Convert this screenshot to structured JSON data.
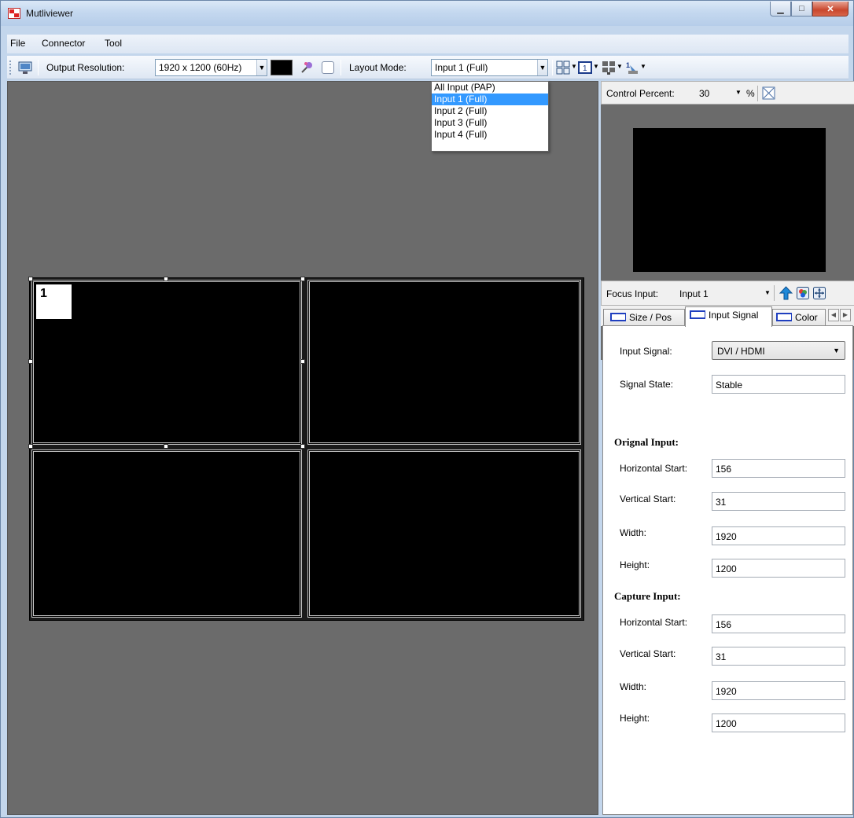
{
  "window": {
    "title": "Mutliviewer"
  },
  "menu": [
    "File",
    "Connector",
    "Tool"
  ],
  "toolbar": {
    "output_resolution_label": "Output Resolution:",
    "output_resolution_value": "1920 x 1200 (60Hz)",
    "layout_mode_label": "Layout Mode:",
    "layout_mode_value": "Input 1 (Full)"
  },
  "layout_dropdown": {
    "options": [
      "All Input (PAP)",
      "Input 1 (Full)",
      "Input 2 (Full)",
      "Input 3 (Full)",
      "Input 4 (Full)"
    ],
    "selected": "Input 1 (Full)"
  },
  "canvas": {
    "selected_cell_number": "1"
  },
  "right_panel": {
    "control_percent_label": "Control Percent:",
    "control_percent_value": "30",
    "percent_unit": "%",
    "focus_input_label": "Focus Input:",
    "focus_input_value": "Input 1",
    "tabs": [
      "Size / Pos",
      "Input Signal",
      "Color"
    ],
    "active_tab": "Input Signal",
    "input_signal_label": "Input Signal:",
    "input_signal_value": "DVI / HDMI",
    "signal_state_label": "Signal State:",
    "signal_state_value": "Stable",
    "original_input": {
      "heading": "Orignal Input:",
      "horizontal_start_label": "Horizontal Start:",
      "horizontal_start": "156",
      "vertical_start_label": "Vertical Start:",
      "vertical_start": "31",
      "width_label": "Width:",
      "width": "1920",
      "height_label": "Height:",
      "height": "1200"
    },
    "capture_input": {
      "heading": "Capture Input:",
      "horizontal_start_label": "Horizontal Start:",
      "horizontal_start": "156",
      "vertical_start_label": "Vertical Start:",
      "vertical_start": "31",
      "width_label": "Width:",
      "width": "1920",
      "height_label": "Height:",
      "height": "1200"
    }
  },
  "colors": {
    "selection": "#3399ff",
    "canvas": "#6b6b6b",
    "accent_icon": "#1f3fbf"
  }
}
